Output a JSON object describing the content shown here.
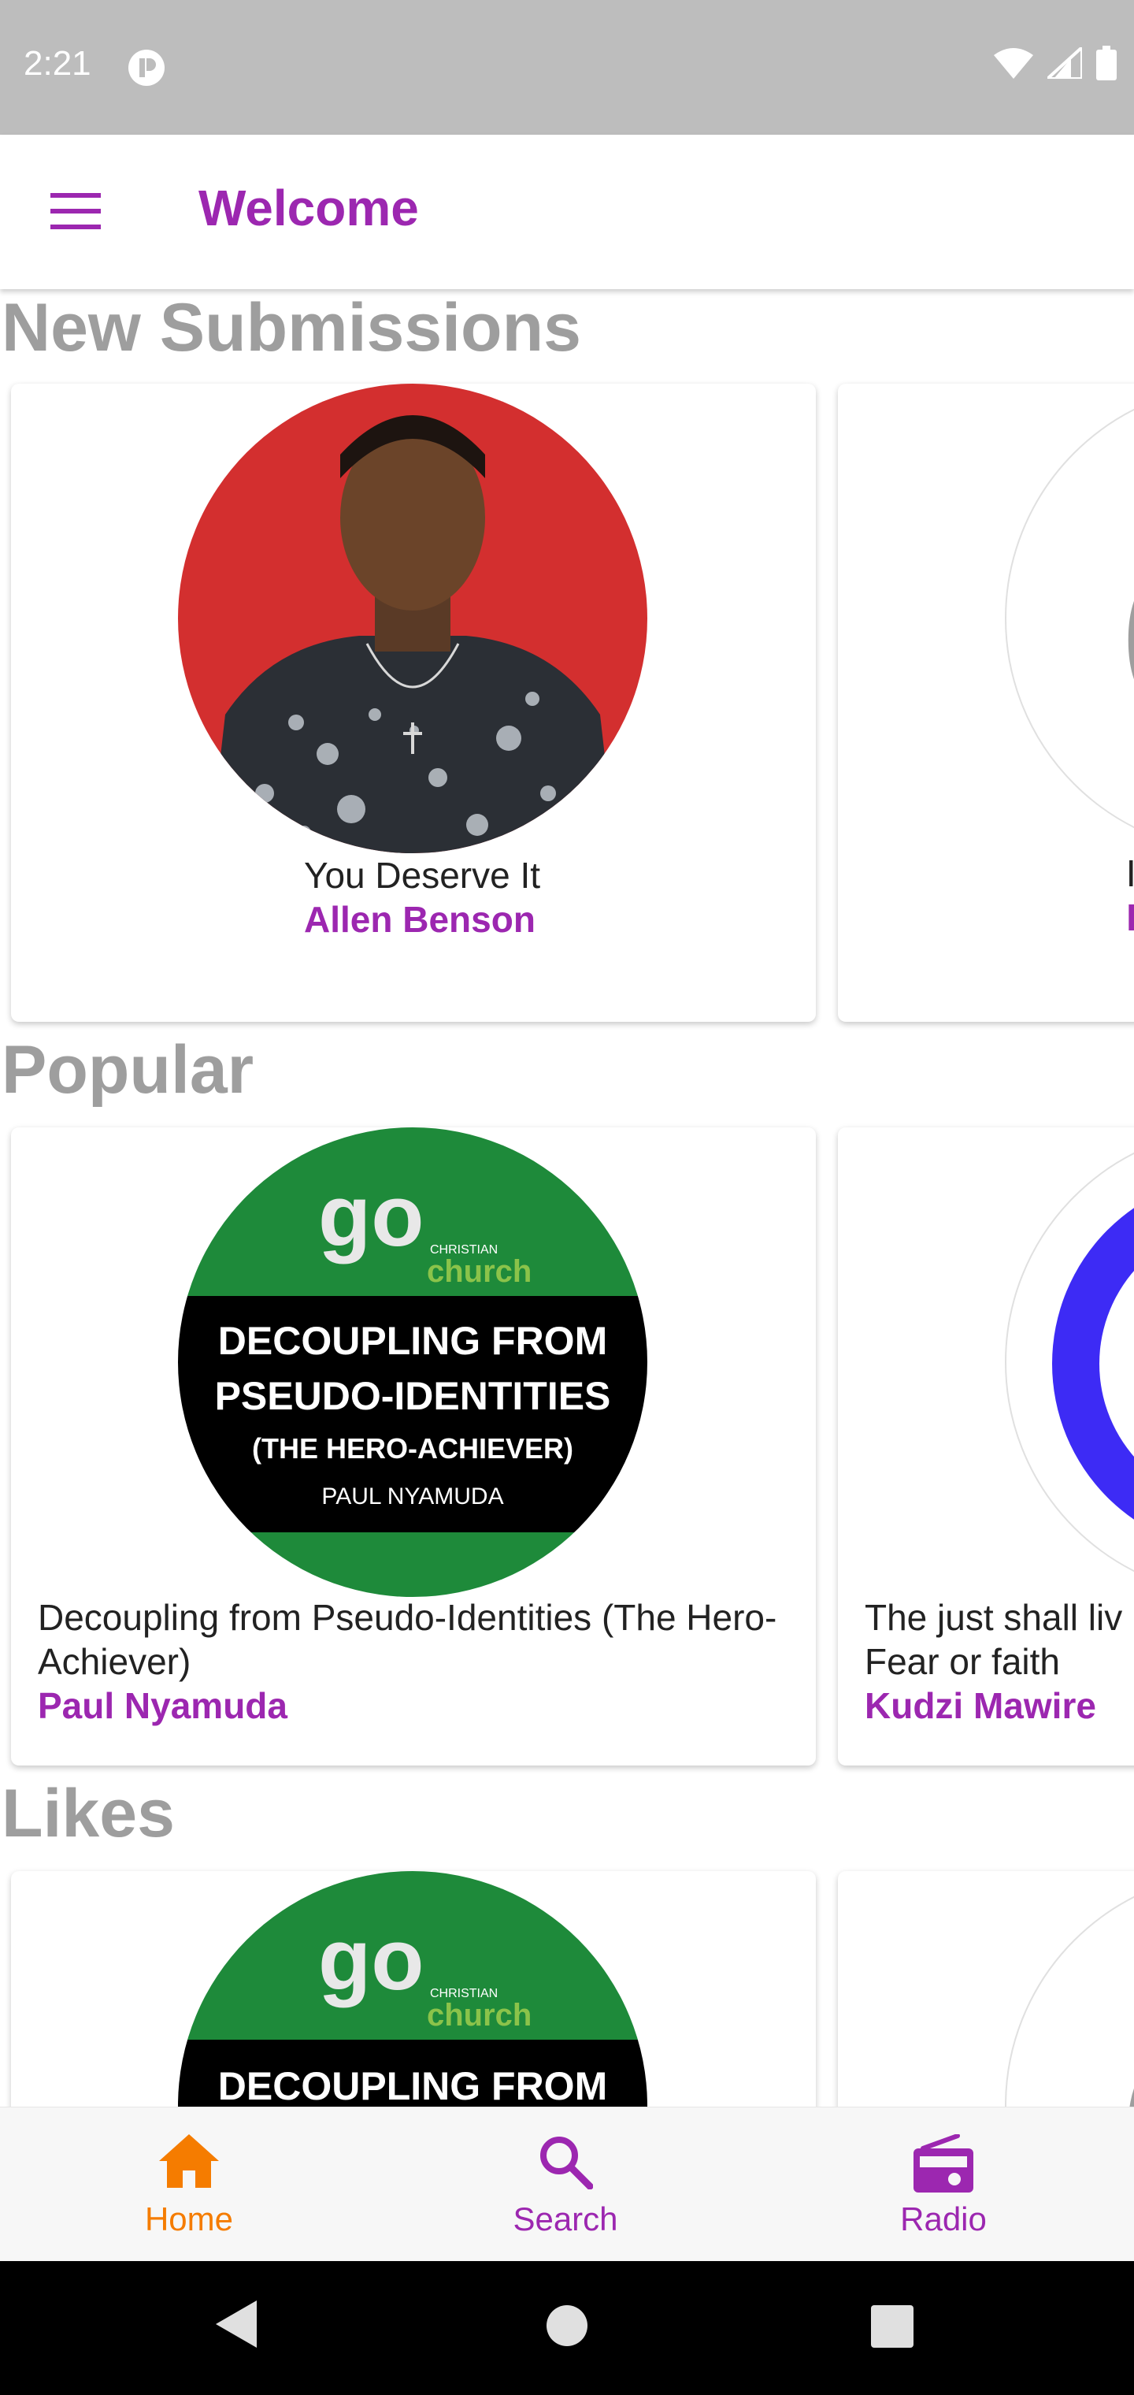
{
  "status_bar": {
    "time": "2:21"
  },
  "app_bar": {
    "title": "Welcome"
  },
  "sections": {
    "new_submissions": {
      "title": "New Submissions",
      "cards": [
        {
          "track": "You Deserve It",
          "artist": "Allen Benson"
        }
      ]
    },
    "popular": {
      "title": "Popular",
      "cards": [
        {
          "track": "Decoupling from Pseudo-Identities (The Hero-Achiever)",
          "artist": "Paul Nyamuda",
          "art_lines": [
            "DECOUPLING FROM",
            "PSEUDO-IDENTITIES",
            "(THE HERO-ACHIEVER)",
            "PAUL NYAMUDA"
          ],
          "art_logo": "go",
          "art_logo_sub": "church",
          "art_logo_small": "CHRISTIAN"
        },
        {
          "track": "The just shall liv",
          "track_line2": "Fear or faith",
          "artist": "Kudzi Mawire"
        }
      ]
    },
    "likes": {
      "title": "Likes",
      "cards": [
        {
          "art_line": "DECOUPLING FROM",
          "art_logo": "go",
          "art_logo_sub": "church",
          "art_logo_small": "CHRISTIAN"
        }
      ]
    }
  },
  "bottom_nav": {
    "items": [
      {
        "label": "Home",
        "icon": "home-icon",
        "active": true
      },
      {
        "label": "Search",
        "icon": "search-icon",
        "active": false
      },
      {
        "label": "Radio",
        "icon": "radio-icon",
        "active": false
      }
    ]
  },
  "colors": {
    "accent": "#9c27b0",
    "active_nav": "#f57c00",
    "section_title": "#9e9e9e",
    "status_bar": "#bdbdbd"
  }
}
